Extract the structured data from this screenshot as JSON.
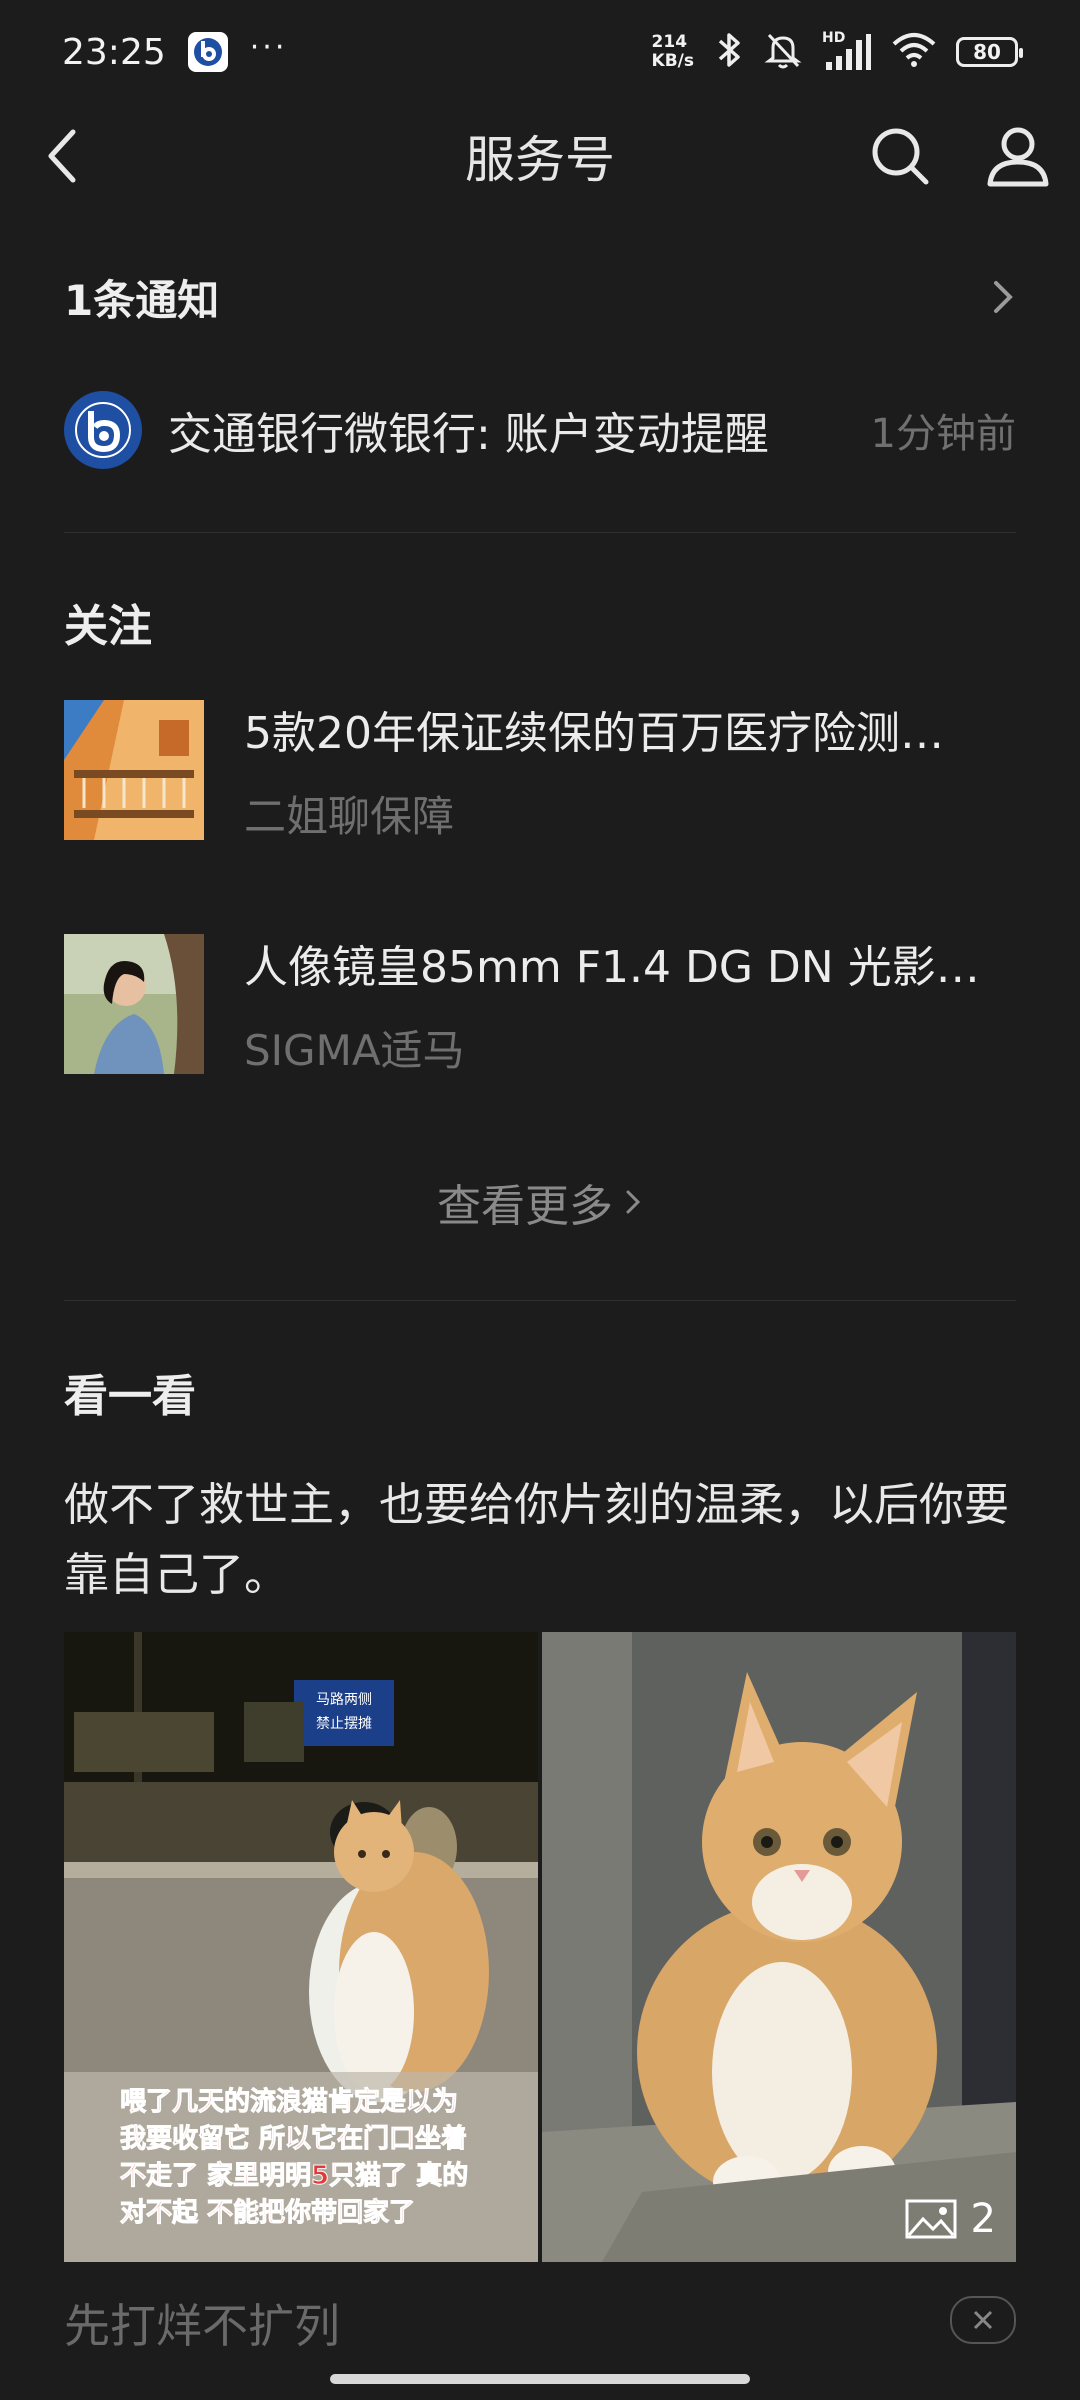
{
  "status": {
    "time": "23:25",
    "dots": "···",
    "net_speed_value": "214",
    "net_speed_unit": "KB/s",
    "signal_label": "HD",
    "battery": "80"
  },
  "nav": {
    "title": "服务号"
  },
  "notice": {
    "header": "1条通知",
    "text": "交通银行微银行: 账户变动提醒",
    "time": "1分钟前"
  },
  "follow": {
    "header": "关注",
    "items": [
      {
        "title": "5款20年保证续保的百万医疗险测…",
        "source": "二姐聊保障"
      },
      {
        "title": "人像镜皇85mm F1.4 DG DN 光影…",
        "source": "SIGMA适马"
      }
    ],
    "see_more": "查看更多"
  },
  "look": {
    "header": "看一看",
    "text": "做不了救世主，也要给你片刻的温柔，以后你要靠自己了。",
    "image_caption_lines": [
      "喂了几天的流浪猫肯定是以为",
      "我要收留它 所以它在门口坐着",
      "不走了 家里明明5只猫了 真的",
      "对不起 不能把你带回家了"
    ],
    "sign_lines": [
      "马路两侧",
      "禁止摆摊"
    ],
    "image_count": "2",
    "next_title": "先打烊不扩列"
  },
  "colors": {
    "background": "#1c1c1c",
    "bank_blue": "#1e4fa2",
    "caption_red": "#e23a3a"
  }
}
